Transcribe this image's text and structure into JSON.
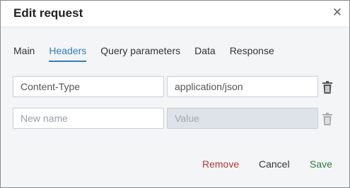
{
  "dialog": {
    "title": "Edit request",
    "close_icon": "close-icon"
  },
  "tabs": [
    {
      "label": "Main",
      "active": false
    },
    {
      "label": "Headers",
      "active": true
    },
    {
      "label": "Query parameters",
      "active": false
    },
    {
      "label": "Data",
      "active": false
    },
    {
      "label": "Response",
      "active": false
    }
  ],
  "headers": {
    "rows": [
      {
        "name": "Content-Type",
        "value": "application/json",
        "delete_icon": "trash-icon"
      }
    ],
    "new_row": {
      "name_placeholder": "New name",
      "value_placeholder": "Value",
      "delete_icon": "trash-icon"
    }
  },
  "actions": {
    "remove": "Remove",
    "cancel": "Cancel",
    "save": "Save"
  },
  "colors": {
    "accent": "#2f7fba",
    "danger": "#b33a3a",
    "success": "#2e7d3e"
  }
}
